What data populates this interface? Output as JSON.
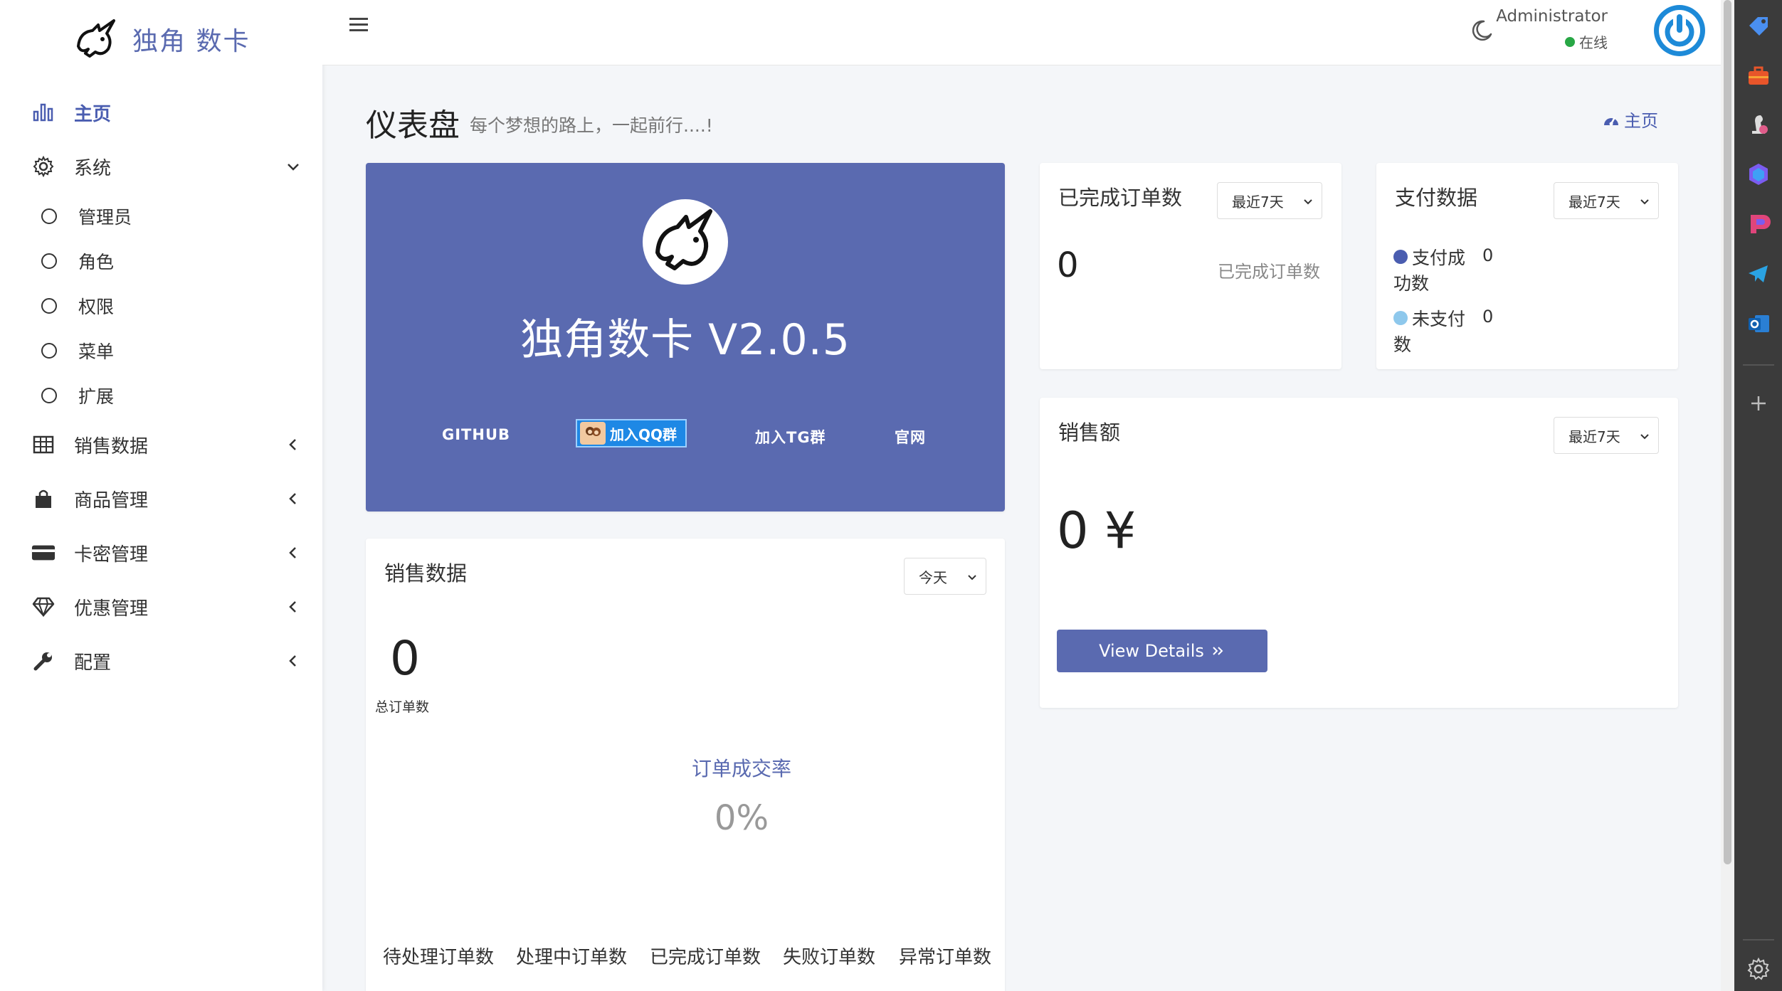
{
  "brand": {
    "name": "独角 数卡"
  },
  "sidebar": {
    "items": [
      {
        "label": "主页"
      },
      {
        "label": "系统"
      },
      {
        "label": "销售数据"
      },
      {
        "label": "商品管理"
      },
      {
        "label": "卡密管理"
      },
      {
        "label": "优惠管理"
      },
      {
        "label": "配置"
      }
    ],
    "system_sub": [
      {
        "label": "管理员"
      },
      {
        "label": "角色"
      },
      {
        "label": "权限"
      },
      {
        "label": "菜单"
      },
      {
        "label": "扩展"
      }
    ]
  },
  "header": {
    "user_name": "Administrator",
    "user_status": "在线"
  },
  "page": {
    "title": "仪表盘",
    "subtitle": "每个梦想的路上，一起前行....!",
    "breadcrumb": "主页"
  },
  "hero": {
    "title": "独角数卡 V2.0.5",
    "links": {
      "github": "GITHUB",
      "qq": "加入QQ群",
      "tg": "加入TG群",
      "site": "官网"
    }
  },
  "orders_card": {
    "title": "已完成订单数",
    "range": "最近7天",
    "value": "0",
    "label": "已完成订单数"
  },
  "pay_card": {
    "title": "支付数据",
    "range": "最近7天",
    "success_label_1": "支付成",
    "success_label_2": "功数",
    "success_value": "0",
    "unpaid_label_1": "未支付",
    "unpaid_label_2": "数",
    "unpaid_value": "0"
  },
  "sales_card": {
    "title": "销售额",
    "range": "最近7天",
    "amount": "0 ¥",
    "button": "View Details"
  },
  "sales_data_card": {
    "title": "销售数据",
    "range": "今天",
    "total": "0",
    "total_label": "总订单数",
    "conversion_label": "订单成交率",
    "conversion_value": "0%",
    "stats": [
      "待处理订单数",
      "处理中订单数",
      "已完成订单数",
      "失败订单数",
      "异常订单数"
    ]
  },
  "colors": {
    "primary": "#5a6ab0",
    "success_dot": "#4a5db0",
    "unpaid_dot": "#8ec8ec",
    "online": "#28a745"
  }
}
